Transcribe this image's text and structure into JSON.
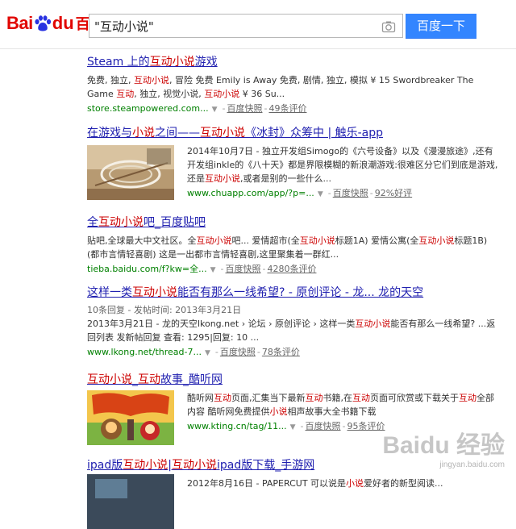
{
  "logo": {
    "bai": "Bai",
    "du": "du",
    "cn": "百度"
  },
  "search": {
    "query": "\"互动小说\"",
    "button": "百度一下"
  },
  "results": [
    {
      "title_parts": [
        "Steam 上的",
        {
          "em": "互动小说"
        },
        "游戏"
      ],
      "desc_parts": [
        "免费, 独立, ",
        {
          "em": "互动小说"
        },
        ", 冒险 免费 Emily is Away 免费, 剧情, 独立, 模拟 ¥ 15 Swordbreaker The Game ",
        {
          "em": "互动"
        },
        ", 独立, 视觉小说, ",
        {
          "em": "互动小说"
        },
        " ¥ 36 Su..."
      ],
      "url": "store.steampowered.com...",
      "snapshot": "百度快照",
      "rating": "49条评价"
    },
    {
      "title_parts": [
        "在游戏与",
        {
          "em": "小说"
        },
        "之间——",
        {
          "em": "互动小说"
        },
        "《冰封》众筹中 | 触乐-app"
      ],
      "meta": "",
      "desc_parts": [
        "2014年10月7日 - 独立开发组Simogo的《六号设备》以及《漫漫旅途》,还有开发组inkle的《八十天》都是界限模糊的新浪潮游戏:很难区分它们到底是游戏,还是",
        {
          "em": "互动小说"
        },
        ",或者是别的一些什么..."
      ],
      "url": "www.chuapp.com/app/?p=...",
      "snapshot": "百度快照",
      "rating": "92%好评"
    },
    {
      "title_parts": [
        "全",
        {
          "em": "互动小说"
        },
        "吧_百度贴吧"
      ],
      "desc_parts": [
        "贴吧,全球最大中文社区。全",
        {
          "em": "互动小说"
        },
        "吧... 爱情超市(全",
        {
          "em": "互动小说"
        },
        "标题1A) 爱情公寓(全",
        {
          "em": "互动小说"
        },
        "标题1B) (都市言情轻喜剧) 这是一出都市言情轻喜剧,这里聚集着一群红..."
      ],
      "url": "tieba.baidu.com/f?kw=全...",
      "snapshot": "百度快照",
      "rating": "4280条评价"
    },
    {
      "title_parts": [
        "这样一类",
        {
          "em": "互动小说"
        },
        "能否有那么一线希望? - 原创评论 - 龙... 龙的天空"
      ],
      "meta": "10条回复 - 发帖时间: 2013年3月21日",
      "desc_parts": [
        "2013年3月21日 - 龙的天空lkong.net › 论坛 › 原创评论 › 这样一类",
        {
          "em": "互动小说"
        },
        "能否有那么一线希望? ...返回列表 发新帖回复 查看: 1295|回复: 10 ..."
      ],
      "url": "www.lkong.net/thread-7...",
      "snapshot": "百度快照",
      "rating": "78条评价"
    },
    {
      "title_parts": [
        {
          "em": "互动小说"
        },
        "_",
        {
          "em": "互动"
        },
        "故事_酷听网"
      ],
      "desc_parts": [
        "酷听网",
        {
          "em": "互动"
        },
        "页面,汇集当下最新",
        {
          "em": "互动"
        },
        "书籍,在",
        {
          "em": "互动"
        },
        "页面可欣赏或下载关于",
        {
          "em": "互动"
        },
        "全部内容 酷听网免费提供",
        {
          "em": "小说"
        },
        "相声故事大全书籍下载"
      ],
      "url": "www.kting.cn/tag/11...",
      "snapshot": "百度快照",
      "rating": "95条评价"
    },
    {
      "title_parts": [
        "ipad版",
        {
          "em": "互动小说"
        },
        "|",
        {
          "em": "互动小说"
        },
        "ipad版下载_手游网"
      ],
      "desc_parts": [
        "2012年8月16日 - PAPERCUT 可以说是",
        {
          "em": "小说"
        },
        "爱好者的新型阅读..."
      ]
    }
  ],
  "watermark": {
    "brand": "Baidu 经验",
    "site": "jingyan.baidu.com"
  }
}
